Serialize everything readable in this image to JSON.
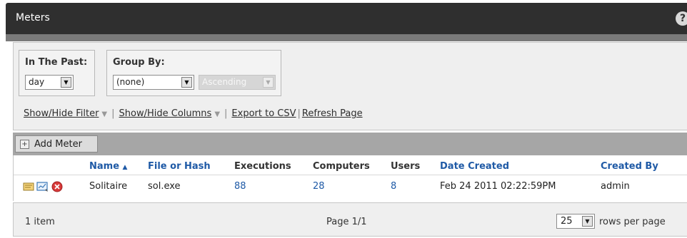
{
  "header": {
    "title": "Meters",
    "help_glyph": "?"
  },
  "filters": {
    "past": {
      "label": "In The Past:",
      "value": "day"
    },
    "group": {
      "label": "Group By:",
      "value": "(none)",
      "order_value": "Ascending",
      "order_disabled": true
    },
    "links": {
      "show_hide_filter": "Show/Hide Filter",
      "show_hide_columns": "Show/Hide Columns",
      "export_csv": "Export to CSV",
      "refresh": "Refresh Page"
    }
  },
  "toolbar": {
    "add_label": "Add Meter",
    "add_icon": "plus-icon"
  },
  "table": {
    "columns": {
      "name": "Name",
      "file": "File or Hash",
      "executions": "Executions",
      "computers": "Computers",
      "users": "Users",
      "date_created": "Date Created",
      "created_by": "Created By"
    },
    "sort": {
      "column": "name",
      "direction": "ascending",
      "indicator": "▲"
    },
    "rows": [
      {
        "actions": [
          "edit-icon",
          "report-icon",
          "delete-icon"
        ],
        "name": "Solitaire",
        "file": "sol.exe",
        "executions": "88",
        "computers": "28",
        "users": "8",
        "date_created": "Feb 24 2011 02:22:59PM",
        "created_by": "admin"
      }
    ]
  },
  "footer": {
    "count": "1 item",
    "page": "Page 1/1",
    "rows_value": "25",
    "rows_label": "rows per page"
  },
  "colors": {
    "titlebar": "#2f2f2f",
    "link": "#1f5aa6",
    "toolbar": "#a6a6a6",
    "panel": "#efefef",
    "delete": "#d83a3a"
  }
}
